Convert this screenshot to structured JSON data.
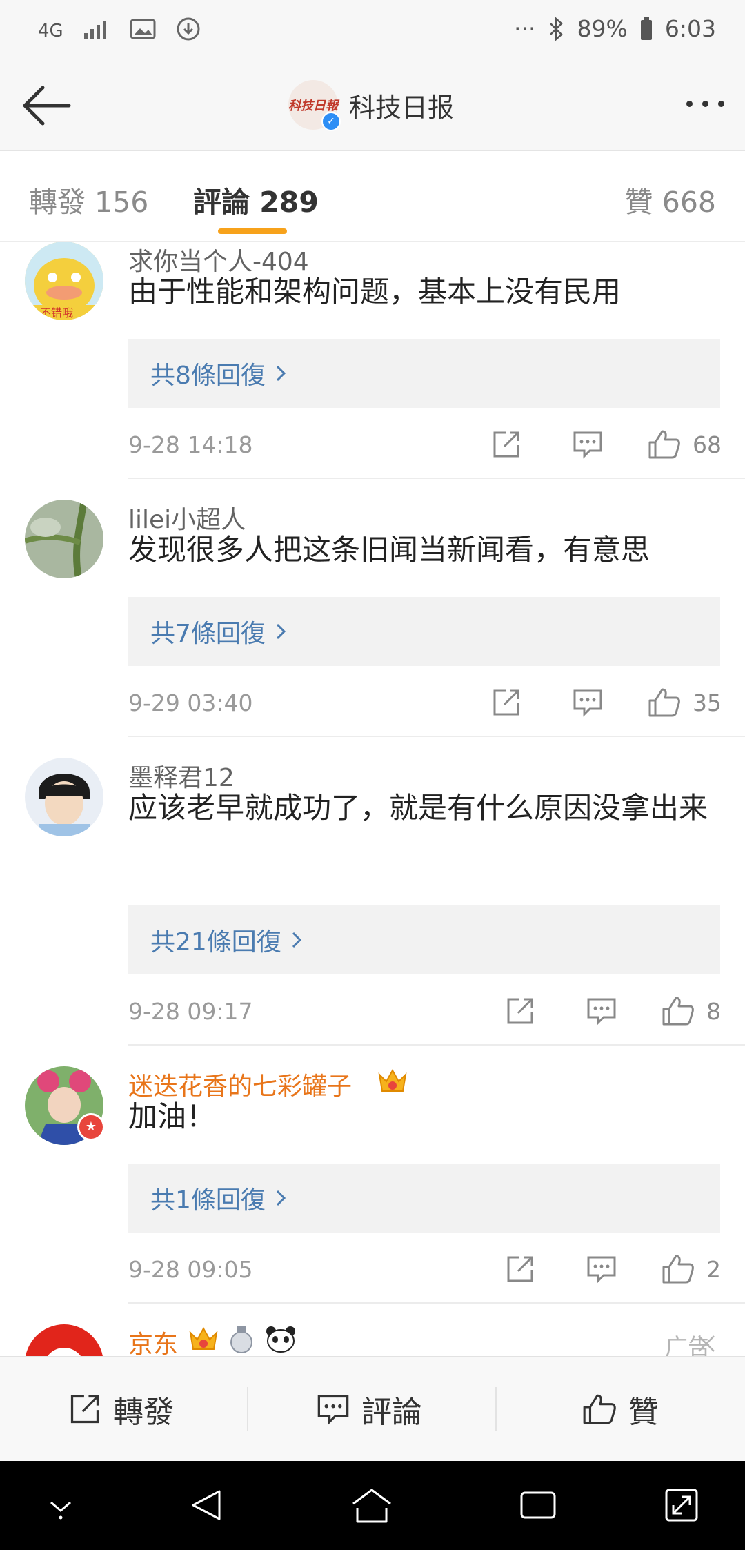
{
  "status_bar": {
    "network": "4G",
    "battery": "89%",
    "time": "6:03",
    "more_dots": "···"
  },
  "header": {
    "title": "科技日报",
    "logo_text": "科技日報",
    "verified_mark": "✓"
  },
  "tabs": [
    {
      "label": "轉發 156"
    },
    {
      "label": "評論 289"
    },
    {
      "label": "贊 668"
    }
  ],
  "colors": {
    "accent": "#f7a21b",
    "link": "#4a7bb0",
    "vip_name": "#e8751a",
    "verified": "#2d8ef5"
  },
  "comments": [
    {
      "username": "求你当个人-404",
      "text": "由于性能和架构问题，基本上没有民用",
      "replies": "共8條回復",
      "time": "9-28 14:18",
      "likes": "68",
      "avatar_text": "不错哦"
    },
    {
      "username": "lilei小超人",
      "text": "发现很多人把这条旧闻当新闻看，有意思",
      "replies": "共7條回復",
      "time": "9-29 03:40",
      "likes": "35"
    },
    {
      "username": "墨释君12",
      "text": "应该老早就成功了，就是有什么原因没拿出来",
      "replies": "共21條回復",
      "time": "9-28 09:17",
      "likes": "8"
    },
    {
      "username": "迷迭花香的七彩罐子",
      "text": "加油！",
      "replies": "共1條回復",
      "time": "9-28 09:05",
      "likes": "2"
    },
    {
      "username": "京东",
      "ad_label": "广告"
    }
  ],
  "bottom_bar": {
    "repost": "轉發",
    "comment": "評論",
    "like": "贊"
  }
}
